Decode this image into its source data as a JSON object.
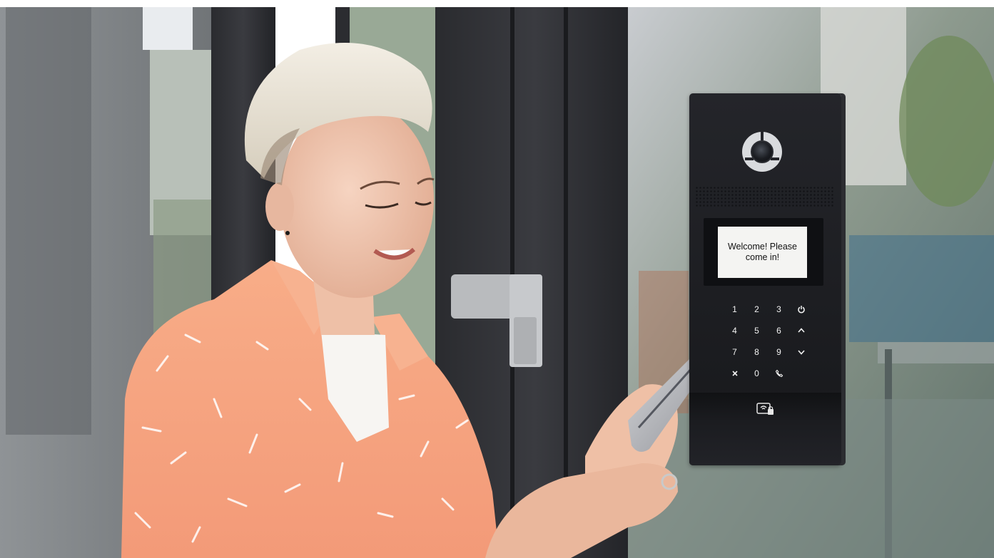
{
  "photo": {
    "subject": "woman with platinum undercut hair in peach patterned shirt holding a smartphone to a door intercom",
    "colors": {
      "shirt": "#f5a07c",
      "hair": "#ece6d8",
      "intercom": "#1f2024",
      "screen": "#f4f4f2"
    }
  },
  "intercom": {
    "display_text": "Welcome! Please come in!",
    "keypad": [
      "1",
      "2",
      "3",
      "power-icon",
      "4",
      "5",
      "6",
      "up-arrow-icon",
      "7",
      "8",
      "9",
      "down-arrow-icon",
      "close-icon",
      "0",
      "call-icon"
    ],
    "icons": [
      "camera-lens-icon",
      "card-reader-icon"
    ]
  }
}
